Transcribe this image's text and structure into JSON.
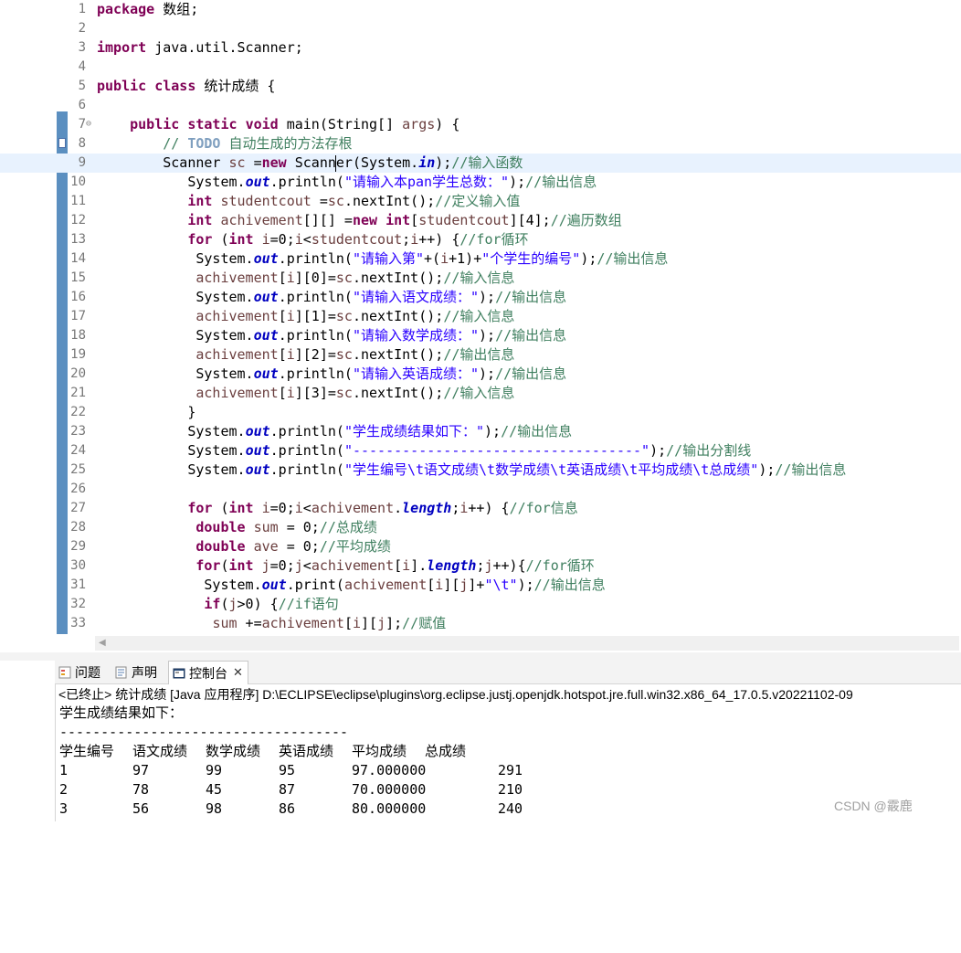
{
  "editor": {
    "lines": [
      {
        "n": "1",
        "tokens": [
          [
            "package",
            "kw"
          ],
          [
            " 数组;",
            ""
          ]
        ]
      },
      {
        "n": "2",
        "tokens": []
      },
      {
        "n": "3",
        "tokens": [
          [
            "import",
            "kw"
          ],
          [
            " java.util.Scanner;",
            ""
          ]
        ]
      },
      {
        "n": "4",
        "tokens": []
      },
      {
        "n": "5",
        "tokens": [
          [
            "public",
            "kw"
          ],
          [
            " ",
            ""
          ],
          [
            "class",
            "kw"
          ],
          [
            " 统计成绩 {",
            ""
          ]
        ]
      },
      {
        "n": "6",
        "tokens": []
      },
      {
        "n": "7",
        "fold": "⊖",
        "tokens": [
          [
            "    ",
            ""
          ],
          [
            "public",
            "kw"
          ],
          [
            " ",
            ""
          ],
          [
            "static",
            "kw"
          ],
          [
            " ",
            ""
          ],
          [
            "void",
            "kw"
          ],
          [
            " main(String[] ",
            ""
          ],
          [
            "args",
            "var"
          ],
          [
            ") {",
            ""
          ]
        ]
      },
      {
        "n": "8",
        "task": true,
        "tokens": [
          [
            "        ",
            ""
          ],
          [
            "// ",
            "cm"
          ],
          [
            "TODO",
            "todo"
          ],
          [
            " 自动生成的方法存根",
            "cm"
          ]
        ]
      },
      {
        "n": "9",
        "current": true,
        "tokens": [
          [
            "        Scanner ",
            ""
          ],
          [
            "sc",
            "var"
          ],
          [
            " =",
            ""
          ],
          [
            "new",
            "kw"
          ],
          [
            " Scann",
            ""
          ],
          [
            "|",
            "cursor"
          ],
          [
            "er(System.",
            ""
          ],
          [
            "in",
            "fld"
          ],
          [
            ");",
            ""
          ],
          [
            "//输入函数",
            "cm"
          ]
        ]
      },
      {
        "n": "10",
        "tokens": [
          [
            "           System.",
            ""
          ],
          [
            "out",
            "fld"
          ],
          [
            ".println(",
            ""
          ],
          [
            "\"请输入本pan学生总数：\"",
            "str"
          ],
          [
            ");",
            ""
          ],
          [
            "//输出信息",
            "cm"
          ]
        ]
      },
      {
        "n": "11",
        "tokens": [
          [
            "           ",
            ""
          ],
          [
            "int",
            "kw"
          ],
          [
            " ",
            ""
          ],
          [
            "studentcout",
            "var"
          ],
          [
            " =",
            ""
          ],
          [
            "sc",
            "var"
          ],
          [
            ".nextInt();",
            ""
          ],
          [
            "//定义输入值",
            "cm"
          ]
        ]
      },
      {
        "n": "12",
        "tokens": [
          [
            "           ",
            ""
          ],
          [
            "int",
            "kw"
          ],
          [
            " ",
            ""
          ],
          [
            "achivement",
            "var"
          ],
          [
            "[][] =",
            ""
          ],
          [
            "new",
            "kw"
          ],
          [
            " ",
            ""
          ],
          [
            "int",
            "kw"
          ],
          [
            "[",
            ""
          ],
          [
            "studentcout",
            "var"
          ],
          [
            "][4];",
            ""
          ],
          [
            "//遍历数组",
            "cm"
          ]
        ]
      },
      {
        "n": "13",
        "tokens": [
          [
            "           ",
            ""
          ],
          [
            "for",
            "kw"
          ],
          [
            " (",
            ""
          ],
          [
            "int",
            "kw"
          ],
          [
            " ",
            ""
          ],
          [
            "i",
            "var"
          ],
          [
            "=0;",
            ""
          ],
          [
            "i",
            "var"
          ],
          [
            "<",
            ""
          ],
          [
            "studentcout",
            "var"
          ],
          [
            ";",
            ""
          ],
          [
            "i",
            "var"
          ],
          [
            "++) {",
            ""
          ],
          [
            "//for循环",
            "cm"
          ]
        ]
      },
      {
        "n": "14",
        "tokens": [
          [
            "            System.",
            ""
          ],
          [
            "out",
            "fld"
          ],
          [
            ".println(",
            ""
          ],
          [
            "\"请输入第\"",
            "str"
          ],
          [
            "+(",
            ""
          ],
          [
            "i",
            "var"
          ],
          [
            "+1)+",
            ""
          ],
          [
            "\"个学生的编号\"",
            "str"
          ],
          [
            ");",
            ""
          ],
          [
            "//输出信息",
            "cm"
          ]
        ]
      },
      {
        "n": "15",
        "tokens": [
          [
            "            ",
            ""
          ],
          [
            "achivement",
            "var"
          ],
          [
            "[",
            ""
          ],
          [
            "i",
            "var"
          ],
          [
            "][0]=",
            ""
          ],
          [
            "sc",
            "var"
          ],
          [
            ".nextInt();",
            ""
          ],
          [
            "//输入信息",
            "cm"
          ]
        ]
      },
      {
        "n": "16",
        "tokens": [
          [
            "            System.",
            ""
          ],
          [
            "out",
            "fld"
          ],
          [
            ".println(",
            ""
          ],
          [
            "\"请输入语文成绩：\"",
            "str"
          ],
          [
            ");",
            ""
          ],
          [
            "//输出信息",
            "cm"
          ]
        ]
      },
      {
        "n": "17",
        "tokens": [
          [
            "            ",
            ""
          ],
          [
            "achivement",
            "var"
          ],
          [
            "[",
            ""
          ],
          [
            "i",
            "var"
          ],
          [
            "][1]=",
            ""
          ],
          [
            "sc",
            "var"
          ],
          [
            ".nextInt();",
            ""
          ],
          [
            "//输入信息",
            "cm"
          ]
        ]
      },
      {
        "n": "18",
        "tokens": [
          [
            "            System.",
            ""
          ],
          [
            "out",
            "fld"
          ],
          [
            ".println(",
            ""
          ],
          [
            "\"请输入数学成绩：\"",
            "str"
          ],
          [
            ");",
            ""
          ],
          [
            "//输出信息",
            "cm"
          ]
        ]
      },
      {
        "n": "19",
        "tokens": [
          [
            "            ",
            ""
          ],
          [
            "achivement",
            "var"
          ],
          [
            "[",
            ""
          ],
          [
            "i",
            "var"
          ],
          [
            "][2]=",
            ""
          ],
          [
            "sc",
            "var"
          ],
          [
            ".nextInt();",
            ""
          ],
          [
            "//输出信息",
            "cm"
          ]
        ]
      },
      {
        "n": "20",
        "tokens": [
          [
            "            System.",
            ""
          ],
          [
            "out",
            "fld"
          ],
          [
            ".println(",
            ""
          ],
          [
            "\"请输入英语成绩：\"",
            "str"
          ],
          [
            ");",
            ""
          ],
          [
            "//输出信息",
            "cm"
          ]
        ]
      },
      {
        "n": "21",
        "tokens": [
          [
            "            ",
            ""
          ],
          [
            "achivement",
            "var"
          ],
          [
            "[",
            ""
          ],
          [
            "i",
            "var"
          ],
          [
            "][3]=",
            ""
          ],
          [
            "sc",
            "var"
          ],
          [
            ".nextInt();",
            ""
          ],
          [
            "//输入信息",
            "cm"
          ]
        ]
      },
      {
        "n": "22",
        "tokens": [
          [
            "           }",
            ""
          ]
        ]
      },
      {
        "n": "23",
        "tokens": [
          [
            "           System.",
            ""
          ],
          [
            "out",
            "fld"
          ],
          [
            ".println(",
            ""
          ],
          [
            "\"学生成绩结果如下：\"",
            "str"
          ],
          [
            ");",
            ""
          ],
          [
            "//输出信息",
            "cm"
          ]
        ]
      },
      {
        "n": "24",
        "tokens": [
          [
            "           System.",
            ""
          ],
          [
            "out",
            "fld"
          ],
          [
            ".println(",
            ""
          ],
          [
            "\"-----------------------------------\"",
            "str"
          ],
          [
            ");",
            ""
          ],
          [
            "//输出分割线",
            "cm"
          ]
        ]
      },
      {
        "n": "25",
        "tokens": [
          [
            "           System.",
            ""
          ],
          [
            "out",
            "fld"
          ],
          [
            ".println(",
            ""
          ],
          [
            "\"学生编号\\t语文成绩\\t数学成绩\\t英语成绩\\t平均成绩\\t总成绩\"",
            "str"
          ],
          [
            ");",
            ""
          ],
          [
            "//输出信息",
            "cm"
          ]
        ]
      },
      {
        "n": "26",
        "tokens": []
      },
      {
        "n": "27",
        "tokens": [
          [
            "           ",
            ""
          ],
          [
            "for",
            "kw"
          ],
          [
            " (",
            ""
          ],
          [
            "int",
            "kw"
          ],
          [
            " ",
            ""
          ],
          [
            "i",
            "var"
          ],
          [
            "=0;",
            ""
          ],
          [
            "i",
            "var"
          ],
          [
            "<",
            ""
          ],
          [
            "achivement",
            "var"
          ],
          [
            ".",
            ""
          ],
          [
            "length",
            "fld"
          ],
          [
            ";",
            ""
          ],
          [
            "i",
            "var"
          ],
          [
            "++) {",
            ""
          ],
          [
            "//for信息",
            "cm"
          ]
        ]
      },
      {
        "n": "28",
        "tokens": [
          [
            "            ",
            ""
          ],
          [
            "double",
            "kw"
          ],
          [
            " ",
            ""
          ],
          [
            "sum",
            "var"
          ],
          [
            " = 0;",
            ""
          ],
          [
            "//总成绩",
            "cm"
          ]
        ]
      },
      {
        "n": "29",
        "tokens": [
          [
            "            ",
            ""
          ],
          [
            "double",
            "kw"
          ],
          [
            " ",
            ""
          ],
          [
            "ave",
            "var"
          ],
          [
            " = 0;",
            ""
          ],
          [
            "//平均成绩",
            "cm"
          ]
        ]
      },
      {
        "n": "30",
        "tokens": [
          [
            "            ",
            ""
          ],
          [
            "for",
            "kw"
          ],
          [
            "(",
            ""
          ],
          [
            "int",
            "kw"
          ],
          [
            " ",
            ""
          ],
          [
            "j",
            "var"
          ],
          [
            "=0;",
            ""
          ],
          [
            "j",
            "var"
          ],
          [
            "<",
            ""
          ],
          [
            "achivement",
            "var"
          ],
          [
            "[",
            ""
          ],
          [
            "i",
            "var"
          ],
          [
            "].",
            ""
          ],
          [
            "length",
            "fld"
          ],
          [
            ";",
            ""
          ],
          [
            "j",
            "var"
          ],
          [
            "++){",
            ""
          ],
          [
            "//for循环",
            "cm"
          ]
        ]
      },
      {
        "n": "31",
        "tokens": [
          [
            "             System.",
            ""
          ],
          [
            "out",
            "fld"
          ],
          [
            ".print(",
            ""
          ],
          [
            "achivement",
            "var"
          ],
          [
            "[",
            ""
          ],
          [
            "i",
            "var"
          ],
          [
            "][",
            ""
          ],
          [
            "j",
            "var"
          ],
          [
            "]+",
            ""
          ],
          [
            "\"\\t\"",
            "str"
          ],
          [
            ");",
            ""
          ],
          [
            "//输出信息",
            "cm"
          ]
        ]
      },
      {
        "n": "32",
        "tokens": [
          [
            "             ",
            ""
          ],
          [
            "if",
            "kw"
          ],
          [
            "(",
            ""
          ],
          [
            "j",
            "var"
          ],
          [
            ">0) {",
            ""
          ],
          [
            "//if语句",
            "cm"
          ]
        ]
      },
      {
        "n": "33",
        "tokens": [
          [
            "              ",
            ""
          ],
          [
            "sum",
            "var"
          ],
          [
            " +=",
            ""
          ],
          [
            "achivement",
            "var"
          ],
          [
            "[",
            ""
          ],
          [
            "i",
            "var"
          ],
          [
            "][",
            ""
          ],
          [
            "j",
            "var"
          ],
          [
            "];",
            ""
          ],
          [
            "//赋值",
            "cm"
          ]
        ]
      }
    ]
  },
  "views": {
    "tabs": [
      {
        "label": "问题",
        "icon": "problems-icon"
      },
      {
        "label": "声明",
        "icon": "declaration-icon"
      },
      {
        "label": "控制台",
        "icon": "console-icon",
        "active": true,
        "close": "✕"
      }
    ]
  },
  "console": {
    "header": "<已终止> 统计成绩 [Java 应用程序] D:\\ECLIPSE\\eclipse\\plugins\\org.eclipse.justj.openjdk.hotspot.jre.full.win32.x86_64_17.0.5.v20221102-09",
    "title_line": "学生成绩结果如下：",
    "divider": "-----------------------------------",
    "columns": [
      "学生编号",
      "语文成绩",
      "数学成绩",
      "英语成绩",
      "平均成绩",
      "总成绩"
    ],
    "rows": [
      [
        "1",
        "97",
        "99",
        "95",
        "97.000000",
        "291"
      ],
      [
        "2",
        "78",
        "45",
        "87",
        "70.000000",
        "210"
      ],
      [
        "3",
        "56",
        "98",
        "86",
        "80.000000",
        "240"
      ]
    ]
  },
  "watermark": "CSDN @霰鹿"
}
